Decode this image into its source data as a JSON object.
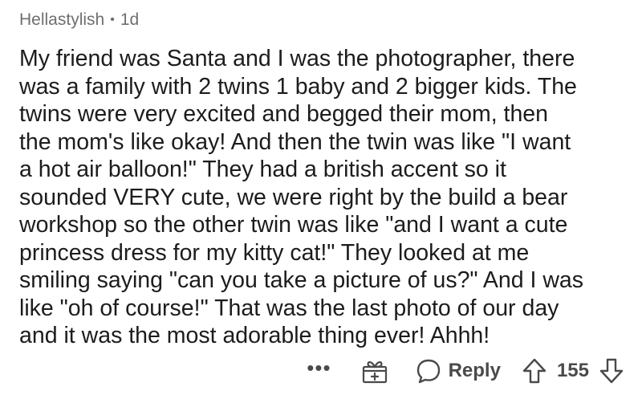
{
  "comment": {
    "author": "Hellastylish",
    "separator": "•",
    "age": "1d",
    "lines": [
      "My friend was Santa and I was the photographer, there",
      "was a family with 2 twins 1 baby and 2 bigger kids. The",
      "twins were very excited and begged their mom, then",
      "the mom's like okay! And then the twin was like \"I want",
      "a hot air balloon!\" They had a british accent so it",
      "sounded VERY cute, we were right by the build a bear",
      "workshop so the other twin was like \"and I want a cute",
      "princess dress for my kitty cat!\" They looked at me",
      "smiling saying \"can you take a picture of us?\" And I was",
      "like \"oh of course!\" That was the last photo of our day",
      "and it was the most adorable thing ever! Ahhh!"
    ]
  },
  "actions": {
    "more_label": "•••",
    "reply_label": "Reply",
    "score": "155",
    "icons": {
      "award": "gift-award-icon",
      "reply": "speech-bubble-icon",
      "upvote": "upvote-arrow-icon",
      "downvote": "downvote-arrow-icon"
    },
    "icon_color": "#4a4a4b"
  }
}
